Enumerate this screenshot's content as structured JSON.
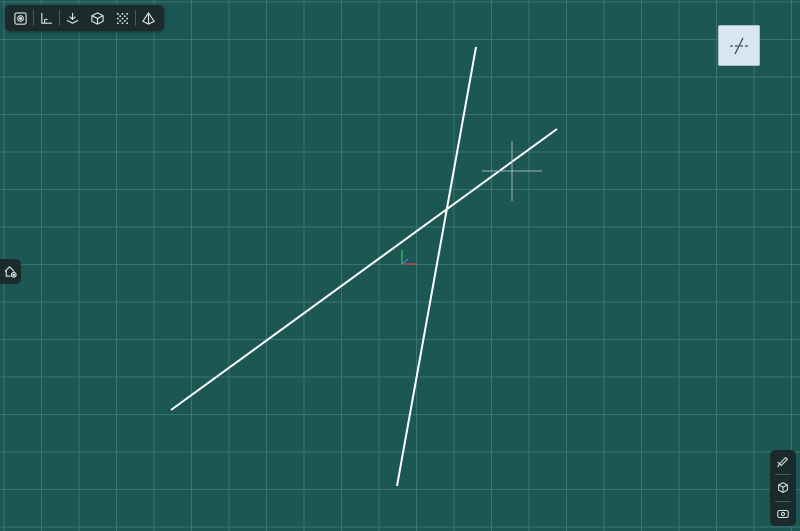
{
  "colors": {
    "background": "#1c5754",
    "grid": "#3b7573",
    "line": "#ffffff",
    "toolbar_bg": "#1d2a2c",
    "icon": "#d8e2e4",
    "view_cube_bg": "#d9e7f1",
    "axis_x": "#d04040",
    "axis_y": "#3fbf5f",
    "axis_z": "#4a7ed8"
  },
  "toolbar": {
    "icons": [
      "snap-target-icon",
      "ortho-corner-icon",
      "layer-down-icon",
      "cube-icon",
      "grid-dots-icon",
      "pyramid-icon"
    ]
  },
  "view_cube": {
    "icon": "line-intersect-icon"
  },
  "left_tool": {
    "icon": "house-settings-icon"
  },
  "right_panel": {
    "icons": [
      "edit-pencil-icon",
      "cube-settings-icon",
      "camera-view-icon"
    ]
  }
}
